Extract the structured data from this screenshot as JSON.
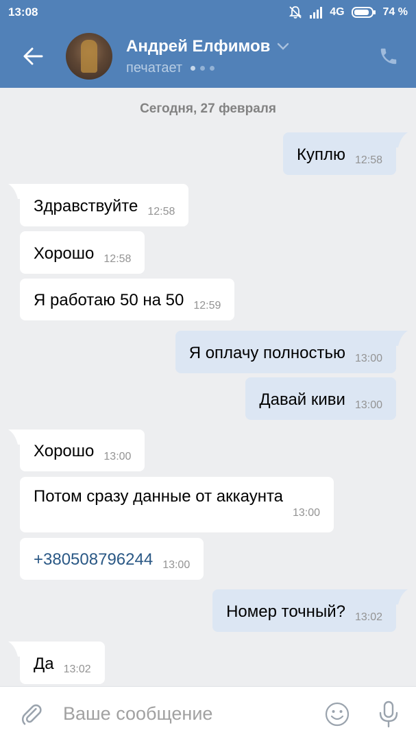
{
  "status_bar": {
    "time": "13:08",
    "network": "4G",
    "battery": "74 %",
    "icons": [
      "muted-bell-icon",
      "signal-icon",
      "battery-icon"
    ]
  },
  "header": {
    "back_icon": "arrow-left-icon",
    "name": "Андрей Елфимов",
    "status": "печатает",
    "call_icon": "phone-icon"
  },
  "chat": {
    "date_separator": "Сегодня, 27 февраля",
    "messages": [
      {
        "dir": "out",
        "text": "Куплю",
        "time": "12:58"
      },
      {
        "dir": "in",
        "text": "Здравствуйте",
        "time": "12:58"
      },
      {
        "dir": "in",
        "text": "Хорошо",
        "time": "12:58"
      },
      {
        "dir": "in",
        "text": "Я работаю 50 на 50",
        "time": "12:59"
      },
      {
        "dir": "out",
        "text": "Я оплачу полностью",
        "time": "13:00"
      },
      {
        "dir": "out",
        "text": "Давай киви",
        "time": "13:00"
      },
      {
        "dir": "in",
        "text": "Хорошо",
        "time": "13:00"
      },
      {
        "dir": "in",
        "text": "Потом сразу данные от аккаунта",
        "time": "13:00"
      },
      {
        "dir": "in",
        "text": "+380508796244",
        "time": "13:00"
      },
      {
        "dir": "out",
        "text": "Номер точный?",
        "time": "13:02"
      },
      {
        "dir": "in",
        "text": "Да",
        "time": "13:02"
      }
    ]
  },
  "composer": {
    "placeholder": "Ваше сообщение",
    "attach_icon": "paperclip-icon",
    "emoji_icon": "smiley-icon",
    "mic_icon": "microphone-icon"
  },
  "colors": {
    "header_bg": "#5181b8",
    "chat_bg": "#edeef0",
    "incoming_bubble": "#ffffff",
    "outgoing_bubble": "#dce6f3",
    "link": "#2a5885"
  }
}
